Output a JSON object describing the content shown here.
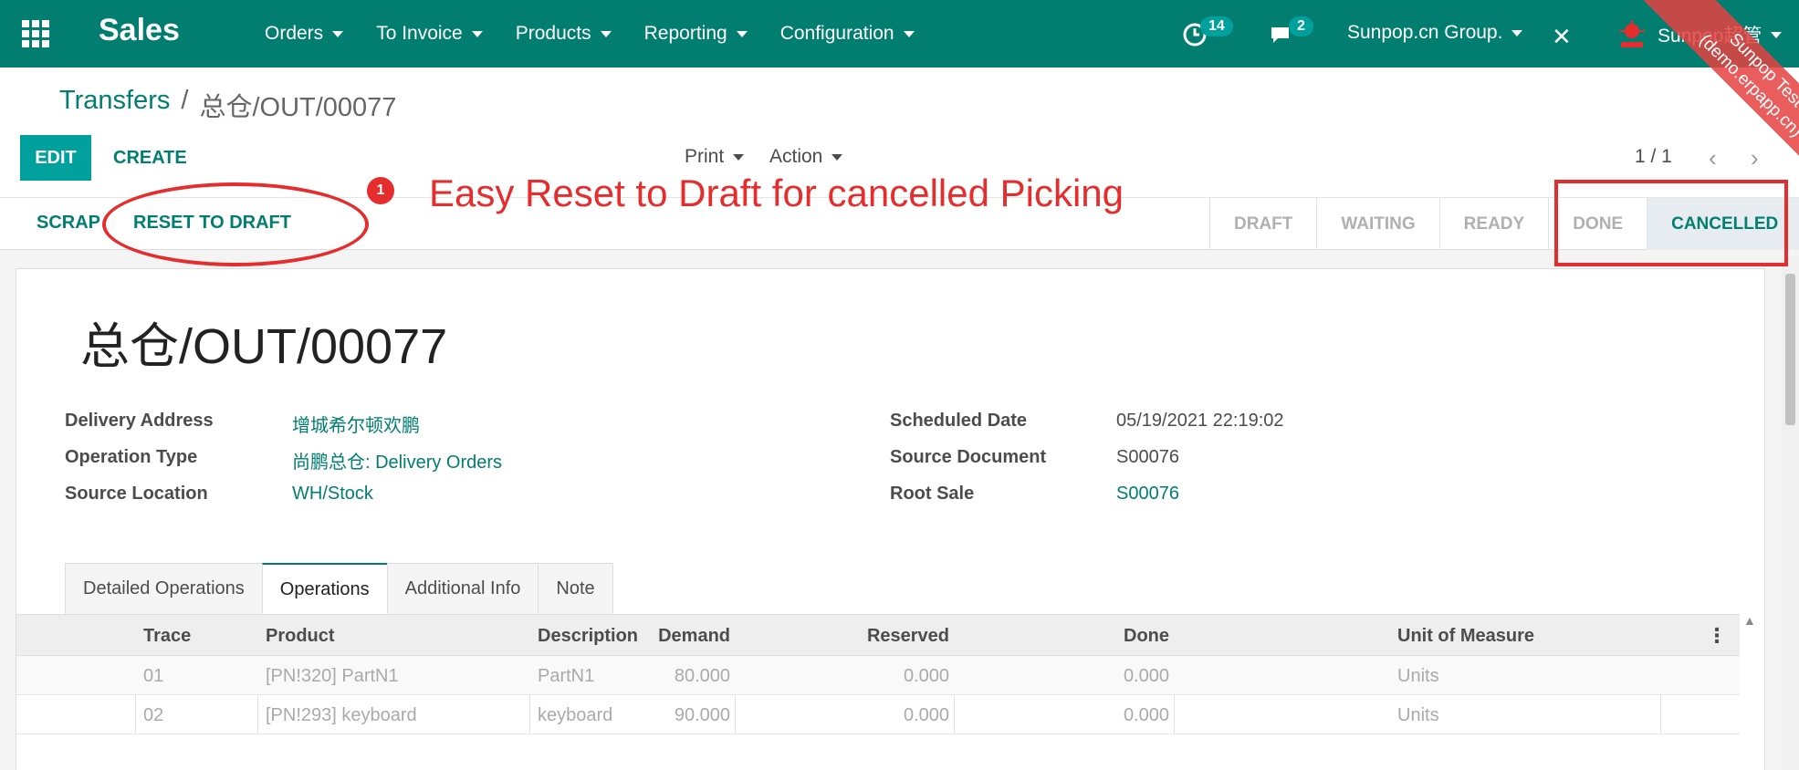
{
  "navbar": {
    "app_name": "Sales",
    "menu": [
      "Orders",
      "To Invoice",
      "Products",
      "Reporting",
      "Configuration"
    ],
    "activity_count": "14",
    "message_count": "2",
    "company": "Sunpop.cn Group.",
    "user": "Sunpop超管"
  },
  "ribbon": {
    "line1": "Sunpop Test",
    "line2": "(demo.erpapp.cn)"
  },
  "breadcrumb": {
    "parent": "Transfers",
    "separator": "/",
    "current": "总仓/OUT/00077"
  },
  "buttons": {
    "edit": "EDIT",
    "create": "CREATE",
    "print": "Print",
    "action": "Action",
    "scrap": "SCRAP",
    "reset": "RESET TO DRAFT"
  },
  "pager": {
    "value": "1 / 1",
    "prev": "‹",
    "next": "›"
  },
  "stages": [
    {
      "label": "DRAFT",
      "active": false
    },
    {
      "label": "WAITING",
      "active": false
    },
    {
      "label": "READY",
      "active": false
    },
    {
      "label": "DONE",
      "active": false
    },
    {
      "label": "CANCELLED",
      "active": true
    }
  ],
  "annotation": {
    "number": "1",
    "text": "Easy Reset to Draft for cancelled Picking",
    "color": "#e52d2d"
  },
  "record": {
    "name": "总仓/OUT/00077",
    "fields_left": [
      {
        "label": "Delivery Address",
        "value": "增城希尔顿欢鹏",
        "link": true
      },
      {
        "label": "Operation Type",
        "value": "尚鹏总仓: Delivery Orders",
        "link": true
      },
      {
        "label": "Source Location",
        "value": "WH/Stock",
        "link": true
      }
    ],
    "fields_right": [
      {
        "label": "Scheduled Date",
        "value": "05/19/2021 22:19:02",
        "link": false
      },
      {
        "label": "Source Document",
        "value": "S00076",
        "link": false
      },
      {
        "label": "Root Sale",
        "value": "S00076",
        "link": true
      }
    ]
  },
  "tabs": [
    {
      "label": "Detailed Operations",
      "active": false
    },
    {
      "label": "Operations",
      "active": true
    },
    {
      "label": "Additional Info",
      "active": false
    },
    {
      "label": "Note",
      "active": false
    }
  ],
  "table": {
    "headers": [
      "Trace",
      "Product",
      "Description",
      "Demand",
      "Reserved",
      "Done",
      "Unit of Measure"
    ],
    "rows": [
      [
        "01",
        "[PN!320] PartN1",
        "PartN1",
        "80.000",
        "0.000",
        "0.000",
        "Units"
      ],
      [
        "02",
        "[PN!293] keyboard",
        "keyboard",
        "90.000",
        "0.000",
        "0.000",
        "Units"
      ]
    ]
  },
  "colors": {
    "brand": "#017e6f",
    "primary_button": "#00a09d",
    "annotation": "#e52d2d"
  }
}
